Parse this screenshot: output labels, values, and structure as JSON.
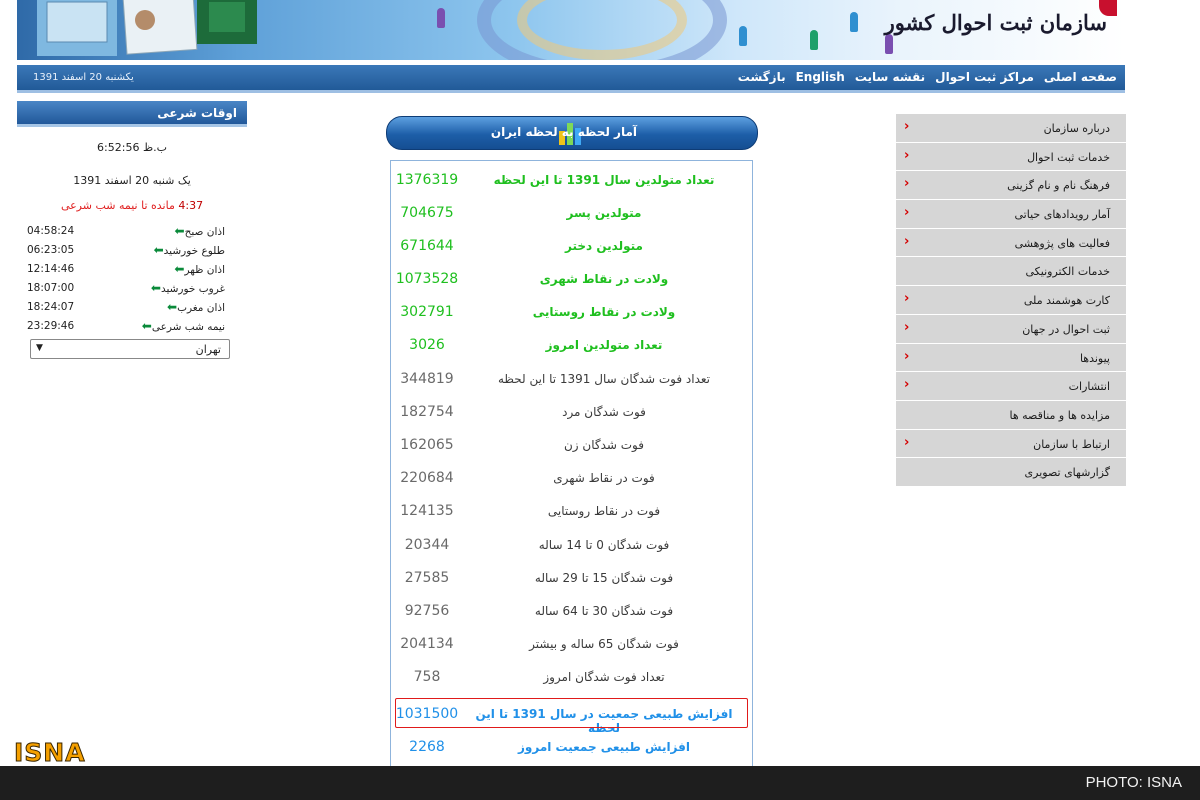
{
  "header": {
    "org_name": "سازمان ثبت احوال کشور"
  },
  "navbar": {
    "date": "یکشنبه 20 اسفند 1391",
    "links": [
      "صفحه اصلی",
      "مراکز ثبت احوال",
      "نقشه سایت",
      "English",
      "بازگشت"
    ]
  },
  "prayer": {
    "title": "اوقات شرعی",
    "clock": "6:52:56 ب.ظ",
    "today": "یک شنبه 20 اسفند 1391",
    "remaining_time": "4:37",
    "remaining_label": "مانده تا نیمه شب شرعی",
    "times": [
      {
        "name": "اذان صبح",
        "time": "04:58:24"
      },
      {
        "name": "طلوع خورشید",
        "time": "06:23:05"
      },
      {
        "name": "اذان ظهر",
        "time": "12:14:46"
      },
      {
        "name": "غروب خورشید",
        "time": "18:07:00"
      },
      {
        "name": "اذان مغرب",
        "time": "18:24:07"
      },
      {
        "name": "نیمه شب شرعی",
        "time": "23:29:46"
      }
    ],
    "city": "تهران"
  },
  "stats": {
    "title": "آمار لحظه به لحظه ایران",
    "rows": [
      {
        "label": "تعداد متولدین سال 1391 تا این لحظه",
        "value": "1376319",
        "style": "green"
      },
      {
        "label": "متولدین پسر",
        "value": "704675",
        "style": "green"
      },
      {
        "label": "متولدین دختر",
        "value": "671644",
        "style": "green"
      },
      {
        "label": "ولادت در نقاط شهری",
        "value": "1073528",
        "style": "green"
      },
      {
        "label": "ولادت در نقاط روستایی",
        "value": "302791",
        "style": "green"
      },
      {
        "label": "تعداد متولدین امروز",
        "value": "3026",
        "style": "green"
      },
      {
        "label": "تعداد فوت شدگان سال 1391 تا این لحظه",
        "value": "344819",
        "style": "gray"
      },
      {
        "label": "فوت شدگان مرد",
        "value": "182754",
        "style": "gray"
      },
      {
        "label": "فوت شدگان زن",
        "value": "162065",
        "style": "gray"
      },
      {
        "label": "فوت در نقاط شهری",
        "value": "220684",
        "style": "gray"
      },
      {
        "label": "فوت در نقاط روستایی",
        "value": "124135",
        "style": "gray"
      },
      {
        "label": "فوت شدگان 0 تا 14 ساله",
        "value": "20344",
        "style": "gray"
      },
      {
        "label": "فوت شدگان 15 تا 29 ساله",
        "value": "27585",
        "style": "gray"
      },
      {
        "label": "فوت شدگان 30 تا 64 ساله",
        "value": "92756",
        "style": "gray"
      },
      {
        "label": "فوت شدگان 65 ساله و بیشتر",
        "value": "204134",
        "style": "gray"
      },
      {
        "label": "تعداد فوت شدگان امروز",
        "value": "758",
        "style": "gray"
      },
      {
        "label": "افزایش طبیعی جمعیت در سال 1391 تا این لحظه",
        "value": "1031500",
        "style": "blue",
        "highlight": true
      },
      {
        "label": "افزایش طبیعی جمعیت امروز",
        "value": "2268",
        "style": "blue"
      }
    ]
  },
  "menu": {
    "items": [
      {
        "label": "درباره سازمان",
        "arrow": true
      },
      {
        "label": "خدمات ثبت احوال",
        "arrow": true
      },
      {
        "label": "فرهنگ نام و نام گزینی",
        "arrow": true
      },
      {
        "label": "آمار رویدادهای حیاتی",
        "arrow": true
      },
      {
        "label": "فعالیت های پژوهشی",
        "arrow": true
      },
      {
        "label": "خدمات الکترونیکی",
        "arrow": false
      },
      {
        "label": "کارت هوشمند ملی",
        "arrow": true
      },
      {
        "label": "ثبت احوال در جهان",
        "arrow": true
      },
      {
        "label": "پیوندها",
        "arrow": true
      },
      {
        "label": "انتشارات",
        "arrow": true
      },
      {
        "label": "مزایده ها و مناقصه ها",
        "arrow": false
      },
      {
        "label": "ارتباط با سازمان",
        "arrow": true
      },
      {
        "label": "گزارشهای تصویری",
        "arrow": false
      }
    ]
  },
  "watermark": {
    "isna": "ISNA",
    "photo_credit": "PHOTO: ISNA"
  },
  "colors": {
    "green": "#1fbf1f",
    "blue": "#2090e8",
    "highlight_border": "#e01a1a",
    "nav_blue": "#215a98",
    "menu_bg": "#d6d6d6"
  }
}
